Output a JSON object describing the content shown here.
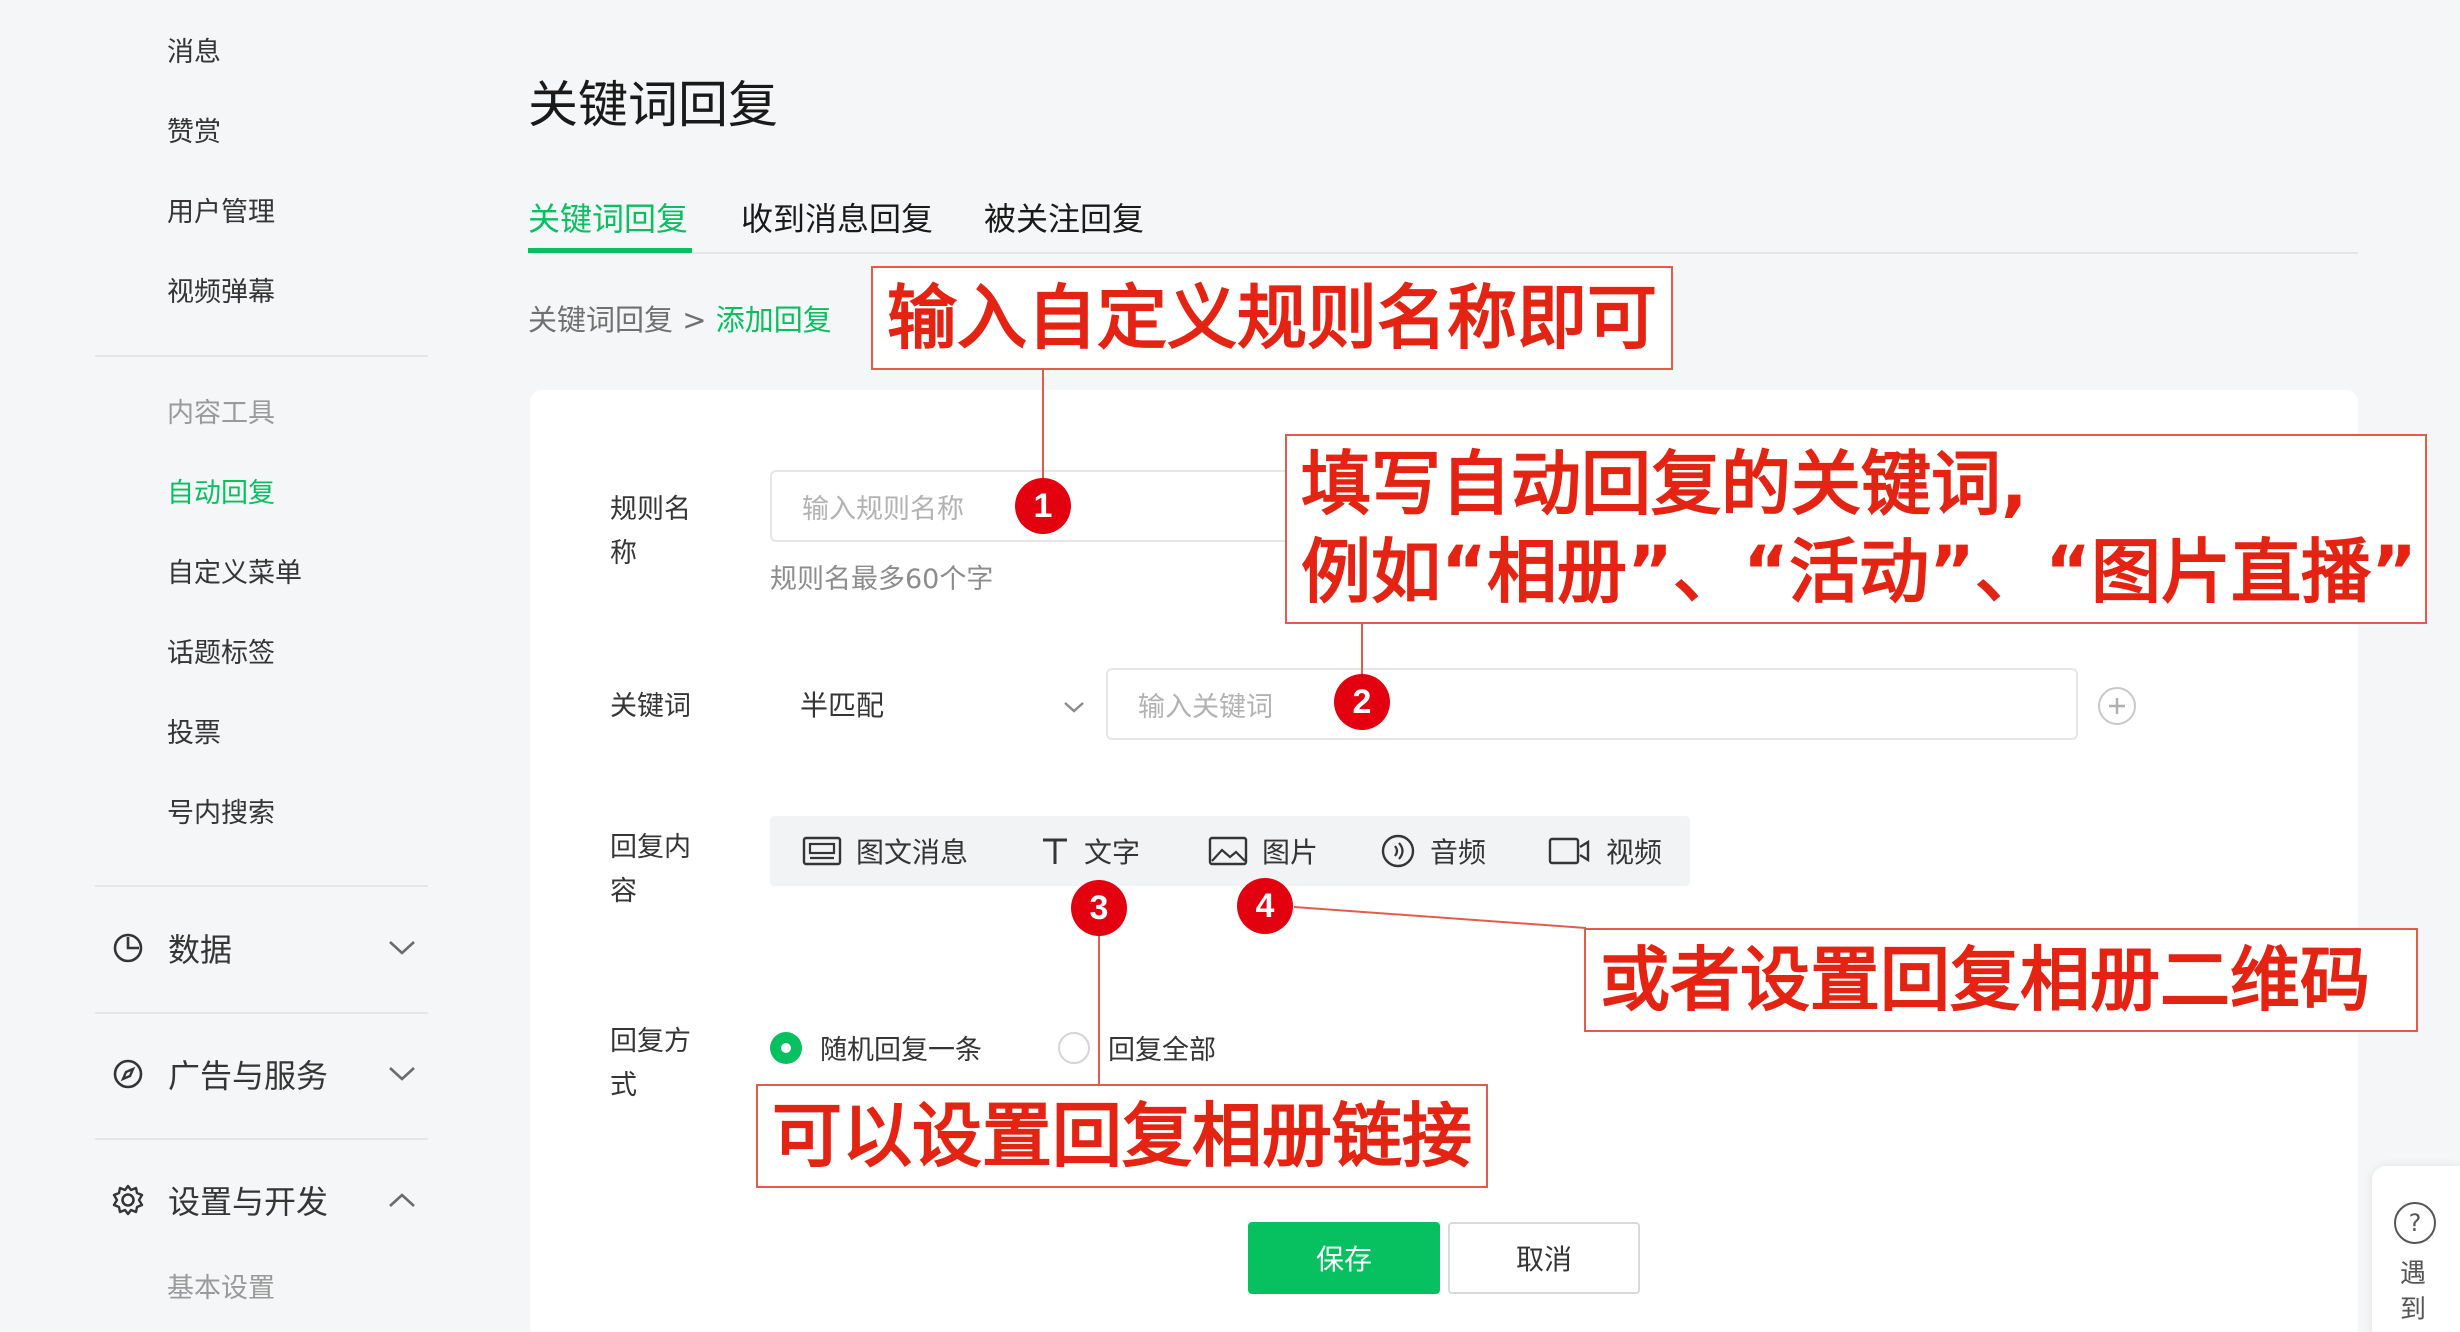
{
  "sidebar": {
    "top_items": [
      {
        "label": "消息"
      },
      {
        "label": "赞赏"
      },
      {
        "label": "用户管理"
      },
      {
        "label": "视频弹幕"
      }
    ],
    "content_tools": {
      "label": "内容工具",
      "items": [
        {
          "label": "自动回复",
          "active": true
        },
        {
          "label": "自定义菜单"
        },
        {
          "label": "话题标签"
        },
        {
          "label": "投票"
        },
        {
          "label": "号内搜索"
        }
      ]
    },
    "groups": [
      {
        "label": "数据",
        "icon": "pie-chart-icon",
        "expanded": false
      },
      {
        "label": "广告与服务",
        "icon": "compass-icon",
        "expanded": false
      },
      {
        "label": "设置与开发",
        "icon": "gear-icon",
        "expanded": true
      }
    ],
    "sub_item": {
      "label": "基本设置"
    }
  },
  "page": {
    "title": "关键词回复"
  },
  "tabs": [
    {
      "label": "关键词回复",
      "active": true
    },
    {
      "label": "收到消息回复"
    },
    {
      "label": "被关注回复"
    }
  ],
  "breadcrumb": {
    "parent": "关键词回复",
    "separator": ">",
    "current": "添加回复"
  },
  "form": {
    "rule_name": {
      "label_line1": "规则名",
      "label_line2": "称",
      "placeholder": "输入规则名称",
      "hint": "规则名最多60个字"
    },
    "keyword": {
      "label": "关键词",
      "match_mode": "半匹配",
      "placeholder": "输入关键词",
      "add_icon": "plus-circle-icon"
    },
    "reply_content": {
      "label_line1": "回复内",
      "label_line2": "容",
      "types": [
        {
          "label": "图文消息",
          "icon": "news-icon"
        },
        {
          "label": "文字",
          "icon": "text-icon"
        },
        {
          "label": "图片",
          "icon": "image-icon"
        },
        {
          "label": "音频",
          "icon": "audio-icon"
        },
        {
          "label": "视频",
          "icon": "video-icon"
        }
      ]
    },
    "reply_mode": {
      "label_line1": "回复方",
      "label_line2": "式",
      "options": [
        {
          "label": "随机回复一条",
          "checked": true
        },
        {
          "label": "回复全部",
          "checked": false
        }
      ]
    },
    "buttons": {
      "save": "保存",
      "cancel": "取消"
    }
  },
  "help_float": {
    "icon": "question-icon",
    "text_line1": "遇",
    "text_line2": "到"
  },
  "annotations": [
    {
      "number": "1",
      "text": "输入自定义规则名称即可"
    },
    {
      "number": "2",
      "line1": "填写自动回复的关键词,",
      "line2": "例如“相册”、“活动”、“图片直播”"
    },
    {
      "number": "3",
      "text": "可以设置回复相册链接"
    },
    {
      "number": "4",
      "text": "或者设置回复相册二维码"
    }
  ],
  "colors": {
    "accent": "#07c160",
    "annotation_red": "#e42313",
    "badge_red": "#e3000f"
  }
}
